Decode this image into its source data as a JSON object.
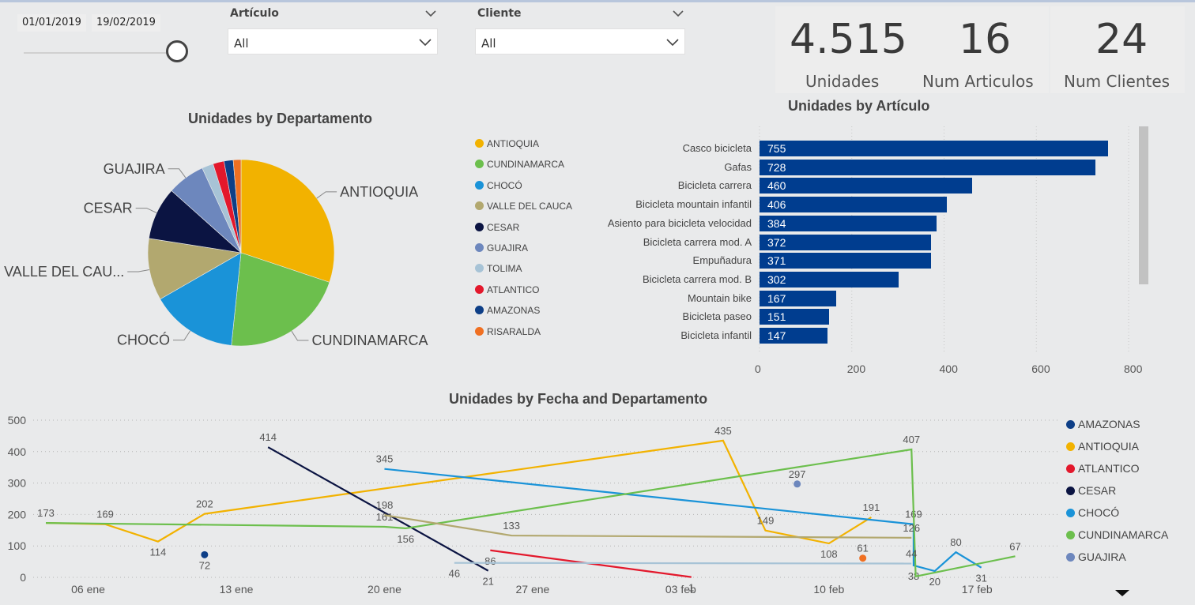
{
  "date_slicer": {
    "start": "01/01/2019",
    "end": "19/02/2019"
  },
  "slicers": [
    {
      "label": "Artículo",
      "value": "All"
    },
    {
      "label": "Cliente",
      "value": "All"
    }
  ],
  "cards": [
    {
      "value": "4.515",
      "label": "Unidades"
    },
    {
      "value": "16",
      "label": "Num Articulos"
    },
    {
      "value": "24",
      "label": "Num Clientes"
    }
  ],
  "colors": {
    "ANTIOQUIA": "#f2b200",
    "CUNDINAMARCA": "#6cbf4d",
    "CHOCÓ": "#1a93d8",
    "VALLE DEL CAUCA": "#b2a86f",
    "CESAR": "#0b1442",
    "GUAJIRA": "#6d87bd",
    "TOLIMA": "#a7c3d6",
    "ATLANTICO": "#e3182c",
    "AMAZONAS": "#0e3f87",
    "RISARALDA": "#f07022",
    "bar": "#003d8f"
  },
  "chart_data": [
    {
      "type": "pie",
      "title": "Unidades by Departamento",
      "legend_position": "right",
      "outside_labels": [
        "ANTIOQUIA",
        "CUNDINAMARCA",
        "CHOCÓ",
        "VALLE DEL CAU...",
        "CESAR",
        "GUAJIRA"
      ],
      "slices": [
        {
          "name": "ANTIOQUIA",
          "value": 1365
        },
        {
          "name": "CUNDINAMARCA",
          "value": 975
        },
        {
          "name": "CHOCÓ",
          "value": 682
        },
        {
          "name": "VALLE DEL CAUCA",
          "value": 487
        },
        {
          "name": "CESAR",
          "value": 414
        },
        {
          "name": "GUAJIRA",
          "value": 297
        },
        {
          "name": "TOLIMA",
          "value": 90
        },
        {
          "name": "ATLANTICO",
          "value": 87
        },
        {
          "name": "AMAZONAS",
          "value": 72
        },
        {
          "name": "RISARALDA",
          "value": 61
        }
      ]
    },
    {
      "type": "bar",
      "orientation": "horizontal",
      "title": "Unidades by Artículo",
      "categories": [
        "Casco bicicleta",
        "Gafas",
        "Bicicleta carrera",
        "Bicicleta mountain infantil",
        "Asiento para bicicleta velocidad",
        "Bicicleta carrera mod. A",
        "Empuñadura",
        "Bicicleta carrera mod. B",
        "Mountain bike",
        "Bicicleta paseo",
        "Bicicleta infantil"
      ],
      "values": [
        755,
        728,
        460,
        406,
        384,
        372,
        371,
        302,
        167,
        151,
        147
      ],
      "xlim": [
        0,
        800
      ],
      "xticks": [
        0,
        200,
        400,
        600,
        800
      ]
    },
    {
      "type": "line",
      "title": "Unidades by Fecha and Departamento",
      "ylim": [
        0,
        500
      ],
      "yticks": [
        0,
        100,
        200,
        300,
        400,
        500
      ],
      "xticks": [
        {
          "label": "06 ene",
          "day": 6
        },
        {
          "label": "13 ene",
          "day": 13
        },
        {
          "label": "20 ene",
          "day": 20
        },
        {
          "label": "27 ene",
          "day": 27
        },
        {
          "label": "03 feb",
          "day": 34
        },
        {
          "label": "10 feb",
          "day": 41
        },
        {
          "label": "17 feb",
          "day": 48
        }
      ],
      "xrange_days": [
        4.0,
        51.5
      ],
      "legend_position": "right",
      "series": [
        {
          "name": "AMAZONAS",
          "points": [
            {
              "day": 11.5,
              "y": 72,
              "label": "72"
            }
          ]
        },
        {
          "name": "ANTIOQUIA",
          "points": [
            {
              "day": 4.0,
              "y": 173,
              "label": "173"
            },
            {
              "day": 6.8,
              "y": 169,
              "label": "169"
            },
            {
              "day": 9.3,
              "y": 114,
              "label": "114"
            },
            {
              "day": 11.5,
              "y": 202,
              "label": "202"
            },
            {
              "day": 36.0,
              "y": 435,
              "label": "435"
            },
            {
              "day": 38.0,
              "y": 149,
              "label": "149"
            },
            {
              "day": 41.0,
              "y": 108,
              "label": "108"
            },
            {
              "day": 43.0,
              "y": 191,
              "label": "191"
            }
          ]
        },
        {
          "name": "ATLANTICO",
          "points": [
            {
              "day": 25.0,
              "y": 86,
              "label": "86"
            },
            {
              "day": 34.5,
              "y": 1,
              "label": "1"
            }
          ]
        },
        {
          "name": "CESAR",
          "points": [
            {
              "day": 14.5,
              "y": 414,
              "label": "414"
            },
            {
              "day": 24.9,
              "y": 21,
              "label": "21"
            }
          ]
        },
        {
          "name": "CHOCÓ",
          "points": [
            {
              "day": 20.0,
              "y": 345,
              "label": "345"
            },
            {
              "day": 45.0,
              "y": 169,
              "label": "169"
            },
            {
              "day": 45.0,
              "y": 38,
              "label": "38"
            },
            {
              "day": 46.0,
              "y": 20,
              "label": "20"
            },
            {
              "day": 47.0,
              "y": 80,
              "label": "80"
            },
            {
              "day": 48.2,
              "y": 31,
              "label": "31"
            }
          ]
        },
        {
          "name": "CUNDINAMARCA",
          "points": [
            {
              "day": 4.0,
              "y": 173,
              "label": ""
            },
            {
              "day": 20.0,
              "y": 161,
              "label": "161"
            },
            {
              "day": 21.0,
              "y": 156,
              "label": "156"
            },
            {
              "day": 44.9,
              "y": 407,
              "label": "407"
            },
            {
              "day": 45.1,
              "y": 3,
              "label": ""
            },
            {
              "day": 49.8,
              "y": 67,
              "label": "67"
            }
          ]
        },
        {
          "name": "GUAJIRA",
          "points": [
            {
              "day": 39.5,
              "y": 297,
              "label": "297"
            }
          ]
        },
        {
          "name": "VALLE DEL CAUCA",
          "points": [
            {
              "day": 20.0,
              "y": 198,
              "label": "198"
            },
            {
              "day": 26.0,
              "y": 133,
              "label": "133"
            },
            {
              "day": 44.9,
              "y": 126,
              "label": "126"
            }
          ]
        },
        {
          "name": "TOLIMA",
          "points": [
            {
              "day": 23.3,
              "y": 46,
              "label": "46"
            },
            {
              "day": 44.9,
              "y": 44,
              "label": "44"
            }
          ]
        },
        {
          "name": "RISARALDA",
          "points": [
            {
              "day": 42.6,
              "y": 61,
              "label": "61"
            }
          ]
        }
      ],
      "legend": [
        "AMAZONAS",
        "ANTIOQUIA",
        "ATLANTICO",
        "CESAR",
        "CHOCÓ",
        "CUNDINAMARCA",
        "GUAJIRA"
      ]
    }
  ]
}
